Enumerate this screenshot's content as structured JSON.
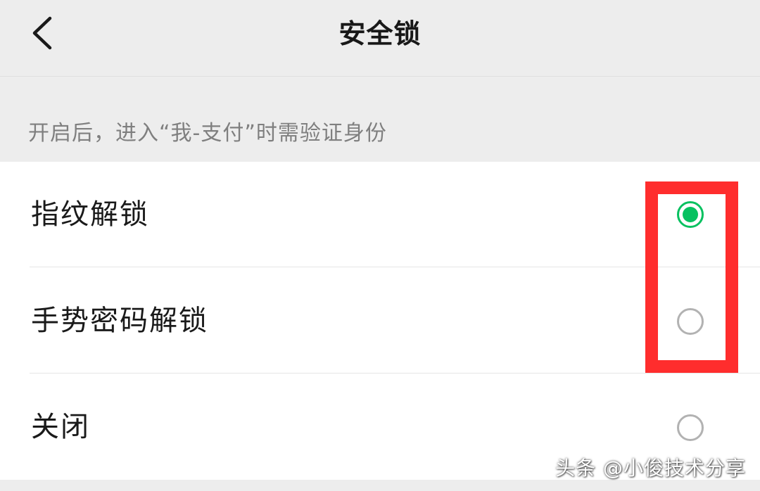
{
  "header": {
    "title": "安全锁",
    "back_icon": "chevron-left-icon"
  },
  "hint": {
    "text": "开启后，进入“我-支付”时需验证身份"
  },
  "options": [
    {
      "label": "指纹解锁",
      "selected": true
    },
    {
      "label": "手势密码解锁",
      "selected": false
    },
    {
      "label": "关闭",
      "selected": false
    }
  ],
  "watermark": {
    "text": "头条 @小俊技术分享"
  },
  "colors": {
    "accent": "#07c160",
    "highlight": "#ff2d2d",
    "background": "#ededed",
    "card": "#ffffff"
  }
}
